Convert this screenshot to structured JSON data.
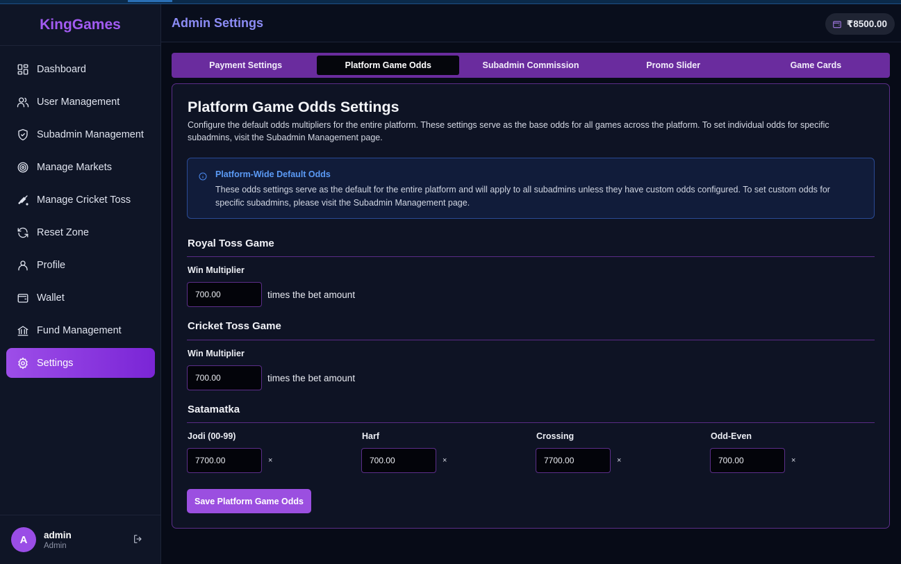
{
  "brand": "KingGames",
  "sidebar": {
    "items": [
      {
        "label": "Dashboard",
        "icon": "dashboard-icon"
      },
      {
        "label": "User Management",
        "icon": "users-icon"
      },
      {
        "label": "Subadmin Management",
        "icon": "shield-icon"
      },
      {
        "label": "Manage Markets",
        "icon": "target-icon"
      },
      {
        "label": "Manage Cricket Toss",
        "icon": "cricket-bat-icon"
      },
      {
        "label": "Reset Zone",
        "icon": "refresh-icon"
      },
      {
        "label": "Profile",
        "icon": "user-icon"
      },
      {
        "label": "Wallet",
        "icon": "wallet-icon"
      },
      {
        "label": "Fund Management",
        "icon": "bank-icon"
      },
      {
        "label": "Settings",
        "icon": "gear-icon",
        "active": true
      }
    ]
  },
  "user": {
    "initial": "A",
    "name": "admin",
    "role": "Admin"
  },
  "header": {
    "title": "Admin Settings",
    "wallet_balance": "₹8500.00"
  },
  "tabs": [
    {
      "label": "Payment Settings"
    },
    {
      "label": "Platform Game Odds",
      "active": true
    },
    {
      "label": "Subadmin Commission"
    },
    {
      "label": "Promo Slider"
    },
    {
      "label": "Game Cards"
    }
  ],
  "card": {
    "title": "Platform Game Odds Settings",
    "description": "Configure the default odds multipliers for the entire platform. These settings serve as the base odds for all games across the platform. To set individual odds for specific subadmins, visit the Subadmin Management page.",
    "info": {
      "title": "Platform-Wide Default Odds",
      "text": "These odds settings serve as the default for the entire platform and will apply to all subadmins unless they have custom odds configured. To set custom odds for specific subadmins, please visit the Subadmin Management page."
    }
  },
  "royal_toss": {
    "title": "Royal Toss Game",
    "label": "Win Multiplier",
    "value": "700.00",
    "suffix": "times the bet amount"
  },
  "cricket_toss": {
    "title": "Cricket Toss Game",
    "label": "Win Multiplier",
    "value": "700.00",
    "suffix": "times the bet amount"
  },
  "satamatka": {
    "title": "Satamatka",
    "times_symbol": "×",
    "fields": [
      {
        "label": "Jodi (00-99)",
        "value": "7700.00"
      },
      {
        "label": "Harf",
        "value": "700.00"
      },
      {
        "label": "Crossing",
        "value": "7700.00"
      },
      {
        "label": "Odd-Even",
        "value": "700.00"
      }
    ]
  },
  "save_label": "Save Platform Game Odds",
  "colors": {
    "accent": "#9b4fe0",
    "brand": "#a25bf2",
    "title": "#8c8cf5",
    "info_blue": "#5b9af5"
  }
}
